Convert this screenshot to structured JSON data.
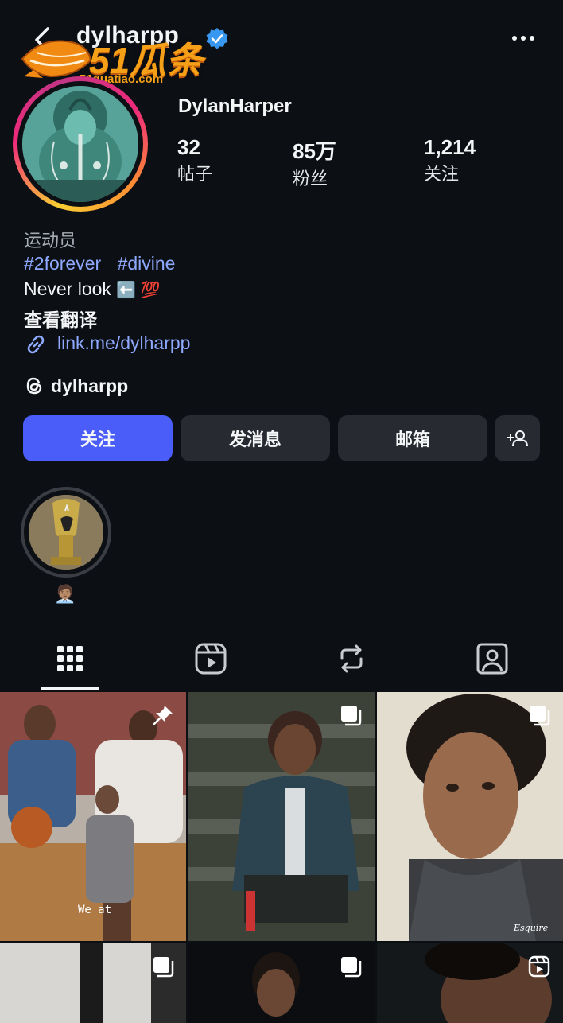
{
  "header": {
    "username": "dylharpp",
    "watermark_brand": "51瓜条",
    "watermark_site": "51guatiao.com"
  },
  "profile": {
    "display_name": "DylanHarper",
    "stats": [
      {
        "value": "32",
        "label": "帖子"
      },
      {
        "value": "85万",
        "label": "粉丝"
      },
      {
        "value": "1,214",
        "label": "关注"
      }
    ],
    "category": "运动员",
    "hashtags": [
      "#2forever",
      "#divine"
    ],
    "bio_text": "Never look",
    "bio_emoji": "⬅️ 💯",
    "translate": "查看翻译",
    "link": "link.me/dylharpp",
    "threads_handle": "dylharpp"
  },
  "actions": {
    "follow": "关注",
    "message": "发消息",
    "email": "邮箱"
  },
  "highlight": {
    "label": "🧑🏽‍💼"
  },
  "tabs": [
    "posts-grid",
    "reels",
    "reposts",
    "tagged"
  ],
  "grid": {
    "cell1_caption": "We at",
    "cell3_caption": "Esquire"
  },
  "colors": {
    "background": "#0c0f14",
    "accent": "#4a5df9",
    "link": "#8ea9ff",
    "button": "#272a31"
  }
}
